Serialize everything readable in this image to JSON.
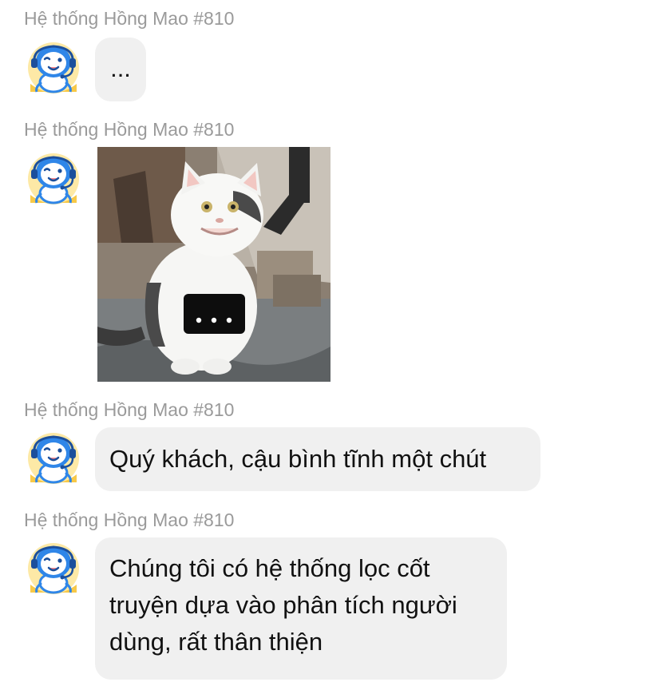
{
  "messages": [
    {
      "sender": "Hệ thống Hồng Mao #810",
      "type": "text",
      "text": "..."
    },
    {
      "sender": "Hệ thống Hồng Mao #810",
      "type": "image",
      "image_overlay_text": "..."
    },
    {
      "sender": "Hệ thống Hồng Mao #810",
      "type": "text",
      "text": "Quý khách, cậu bình tĩnh một chút"
    },
    {
      "sender": "Hệ thống Hồng Mao #810",
      "type": "text",
      "text": "Chúng tôi có hệ thống lọc cốt truyện dựa vào phân tích người dùng, rất thân thiện"
    }
  ],
  "colors": {
    "bubble": "#f0f0f0",
    "sender_text": "#9a9a9a",
    "avatar_primary": "#2f86e8",
    "avatar_accent": "#f7c948"
  },
  "icons": {
    "avatar": "robot-mascot-avatar"
  }
}
